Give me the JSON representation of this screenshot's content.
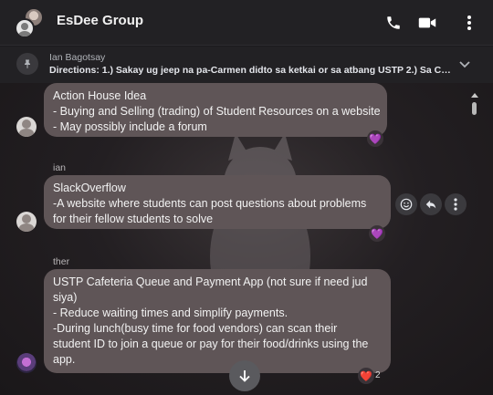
{
  "header": {
    "group_name": "EsDee Group",
    "icons": [
      "phone-icon",
      "video-camera-icon",
      "more-options-icon"
    ]
  },
  "pinned": {
    "author": "Ian Bagotsay",
    "text": "Directions: 1.) Sakay ug jeep na pa-Carmen didto sa ketkai or sa atbang USTP 2.) Sa Ca..."
  },
  "messages": [
    {
      "sender": "",
      "lines": [
        "Action House Idea",
        "- Buying and Selling (trading) of Student Resources on a website",
        "- May possibly include a forum"
      ],
      "reaction": "💜"
    },
    {
      "sender": "ian",
      "lines": [
        "SlackOverflow",
        "-A website where students can post questions about problems",
        "for their fellow students to solve"
      ],
      "reaction": "💜"
    },
    {
      "sender": "ther",
      "lines": [
        "USTP Cafeteria Queue and Payment App (not sure if need jud",
        "siya)",
        "- Reduce waiting times and simplify payments.",
        "-During lunch(busy time for food vendors) can scan their",
        "student ID to join a queue or pay for their food/drinks using the",
        "app."
      ],
      "reaction": "❤️",
      "reaction_count": "2"
    }
  ],
  "colors": {
    "bubble": "#5f5557",
    "background": "#1b1a1d",
    "reaction_purple": "#9b59f5"
  }
}
